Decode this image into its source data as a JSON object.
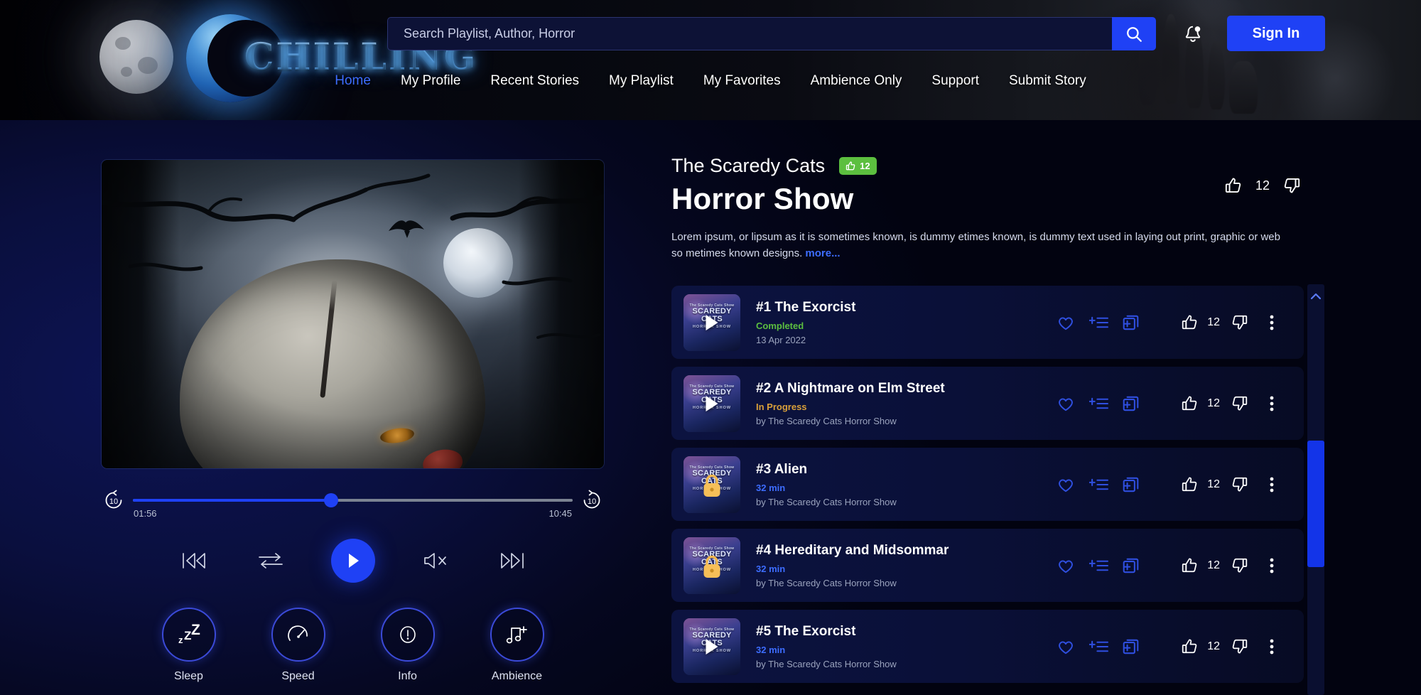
{
  "brand": {
    "name": "CHILLING",
    "logo_icon": "crescent-moon-skull-icon"
  },
  "search": {
    "placeholder": "Search Playlist, Author, Horror",
    "value": "",
    "button_icon": "search-icon"
  },
  "header": {
    "bell_icon": "notification-bell-icon",
    "signin_label": "Sign In",
    "accent_color": "#1f41f5"
  },
  "nav": {
    "items": [
      {
        "label": "Home",
        "active": true
      },
      {
        "label": "My Profile",
        "active": false
      },
      {
        "label": "Recent Stories",
        "active": false
      },
      {
        "label": "My Playlist",
        "active": false
      },
      {
        "label": "My Favorites",
        "active": false
      },
      {
        "label": "Ambience Only",
        "active": false
      },
      {
        "label": "Support",
        "active": false
      },
      {
        "label": "Submit Story",
        "active": false
      }
    ],
    "active_color": "#3d6dff"
  },
  "player": {
    "artwork_alt": "horror-clown-moonlit-forest-artwork",
    "current_time": "01:56",
    "total_time": "10:45",
    "progress_percent": 45,
    "skip_back_label": "10",
    "skip_forward_label": "10",
    "skip_back_icon": "rewind-10-icon",
    "skip_forward_icon": "forward-10-icon",
    "controls": {
      "previous_icon": "previous-track-icon",
      "repeat_icon": "repeat-shuffle-icon",
      "play_icon": "play-icon",
      "mute_icon": "volume-mute-icon",
      "next_icon": "next-track-icon"
    },
    "quick_actions": [
      {
        "label": "Sleep",
        "icon": "sleep-zzz-icon"
      },
      {
        "label": "Speed",
        "icon": "speedometer-icon"
      },
      {
        "label": "Info",
        "icon": "info-exclamation-icon"
      },
      {
        "label": "Ambience",
        "icon": "music-note-plus-icon"
      }
    ]
  },
  "show": {
    "subtitle": "The Scaredy Cats",
    "title": "Horror Show",
    "badge": {
      "icon": "thumbs-up-icon",
      "count": "12",
      "color": "#5cbf3f"
    },
    "description": "Lorem ipsum, or lipsum as it is sometimes known, is dummy etimes known, is dummy  text used in laying out print, graphic or web so metimes known designs.",
    "more_label": "more...",
    "rating": {
      "like_icon": "thumbs-up-icon",
      "like_count": "12",
      "dislike_icon": "thumbs-down-icon"
    }
  },
  "episodes": [
    {
      "title": "#1 The Exorcist",
      "status": "Completed",
      "status_color": "#5cbf3f",
      "meta": "13 Apr 2022",
      "locked": false,
      "like_count": "12",
      "thumb_line1": "The Scaredy Cats Show",
      "thumb_line2": "SCAREDY CATS",
      "thumb_line3": "HORROR SHOW"
    },
    {
      "title": "#2 A Nightmare on Elm Street",
      "status": "In Progress",
      "status_color": "#d9a03a",
      "meta": "by The Scaredy Cats Horror Show",
      "locked": false,
      "like_count": "12",
      "thumb_line1": "The Scaredy Cats Show",
      "thumb_line2": "SCAREDY CATS",
      "thumb_line3": "HORROR SHOW"
    },
    {
      "title": "#3 Alien",
      "status": "32 min",
      "status_color": "#3d6dff",
      "meta": "by The Scaredy Cats Horror Show",
      "locked": true,
      "like_count": "12",
      "thumb_line1": "The Scaredy Cats Show",
      "thumb_line2": "SCAREDY CATS",
      "thumb_line3": "HORROR SHOW"
    },
    {
      "title": "#4 Hereditary and Midsommar",
      "status": "32 min",
      "status_color": "#3d6dff",
      "meta": "by The Scaredy Cats Horror Show",
      "locked": true,
      "like_count": "12",
      "thumb_line1": "The Scaredy Cats Show",
      "thumb_line2": "SCAREDY CATS",
      "thumb_line3": "HORROR SHOW"
    },
    {
      "title": "#5 The Exorcist",
      "status": "32 min",
      "status_color": "#3d6dff",
      "meta": "by The Scaredy Cats Horror Show",
      "locked": false,
      "like_count": "12",
      "thumb_line1": "The Scaredy Cats Show",
      "thumb_line2": "SCAREDY CATS",
      "thumb_line3": "HORROR SHOW"
    }
  ],
  "row_action_icons": {
    "favorite": "heart-icon",
    "add_to_playlist": "add-to-playlist-icon",
    "add_to_library": "add-to-library-icon",
    "like": "thumbs-up-icon",
    "dislike": "thumbs-down-icon",
    "more": "more-vertical-icon"
  },
  "scrollbar": {
    "up_icon": "chevron-up-icon",
    "thumb_color": "#1334e8"
  }
}
